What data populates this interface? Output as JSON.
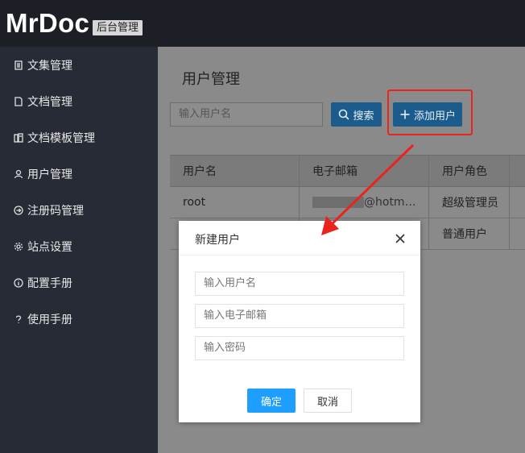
{
  "app": {
    "logo": "MrDoc",
    "badge": "后台管理"
  },
  "sidebar": {
    "items": [
      {
        "label": "文集管理",
        "icon": "book-icon"
      },
      {
        "label": "文档管理",
        "icon": "document-icon"
      },
      {
        "label": "文档模板管理",
        "icon": "template-icon"
      },
      {
        "label": "用户管理",
        "icon": "user-icon"
      },
      {
        "label": "注册码管理",
        "icon": "register-code-icon"
      },
      {
        "label": "站点设置",
        "icon": "gear-icon"
      },
      {
        "label": "配置手册",
        "icon": "info-icon"
      },
      {
        "label": "使用手册",
        "icon": "question-icon"
      }
    ]
  },
  "main": {
    "title": "用户管理",
    "search_placeholder": "输入用户名",
    "search_button": "搜索",
    "add_button": "添加用户"
  },
  "table": {
    "columns": [
      "用户名",
      "电子邮箱",
      "用户角色"
    ],
    "rows": [
      {
        "username": "root",
        "email": "@hotm…",
        "role": "超级管理员"
      },
      {
        "username": "",
        "email": "",
        "role": "普通用户"
      }
    ]
  },
  "dialog": {
    "title": "新建用户",
    "username_placeholder": "输入用户名",
    "email_placeholder": "输入电子邮箱",
    "password_placeholder": "输入密码",
    "confirm": "确定",
    "cancel": "取消"
  },
  "colors": {
    "primary": "#1e9fff",
    "annotation": "#e8241c",
    "sidebar": "#272b35",
    "topbar": "#1d1f26"
  }
}
